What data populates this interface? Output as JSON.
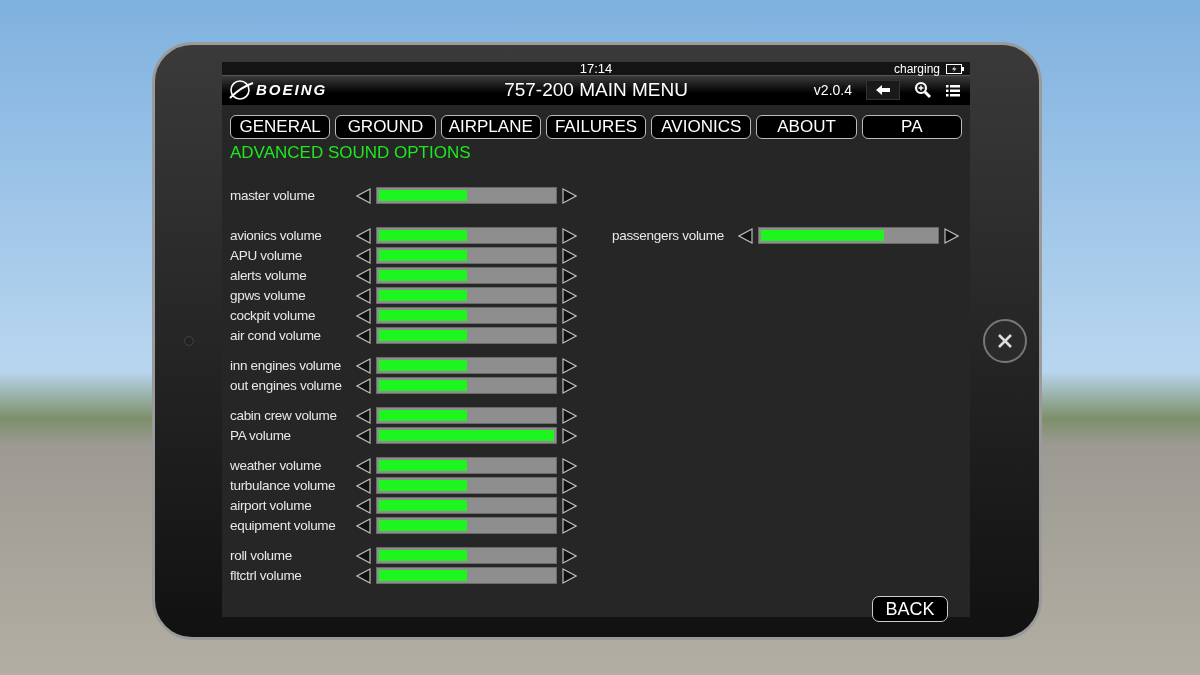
{
  "status_bar": {
    "time": "17:14",
    "battery_label": "charging"
  },
  "title_bar": {
    "logo": "BOEING",
    "title": "757-200 MAIN MENU",
    "version": "v2.0.4"
  },
  "tabs": [
    {
      "label": "GENERAL"
    },
    {
      "label": "GROUND"
    },
    {
      "label": "AIRPLANE"
    },
    {
      "label": "FAILURES"
    },
    {
      "label": "AVIONICS"
    },
    {
      "label": "ABOUT"
    },
    {
      "label": "PA"
    }
  ],
  "heading": "ADVANCED SOUND OPTIONS",
  "left_groups": [
    [
      {
        "name": "master volume",
        "level": 0.5
      }
    ],
    [
      {
        "name": "avionics volume",
        "level": 0.5
      },
      {
        "name": "APU volume",
        "level": 0.5
      },
      {
        "name": "alerts volume",
        "level": 0.5
      },
      {
        "name": "gpws volume",
        "level": 0.5
      },
      {
        "name": "cockpit volume",
        "level": 0.5
      },
      {
        "name": "air cond volume",
        "level": 0.5
      }
    ],
    [
      {
        "name": "inn engines volume",
        "level": 0.5
      },
      {
        "name": "out engines volume",
        "level": 0.5
      }
    ],
    [
      {
        "name": "cabin crew volume",
        "level": 0.5
      },
      {
        "name": "PA volume",
        "level": 1
      }
    ],
    [
      {
        "name": "weather volume",
        "level": 0.5
      },
      {
        "name": "turbulance volume",
        "level": 0.5
      },
      {
        "name": "airport volume",
        "level": 0.5
      },
      {
        "name": "equipment volume",
        "level": 0.5
      }
    ],
    [
      {
        "name": "roll volume",
        "level": 0.5
      },
      {
        "name": "fltctrl volume",
        "level": 0.5
      }
    ]
  ],
  "right_sliders": [
    {
      "name": "passengers volume",
      "level": 0.7
    }
  ],
  "back_button": "BACK"
}
